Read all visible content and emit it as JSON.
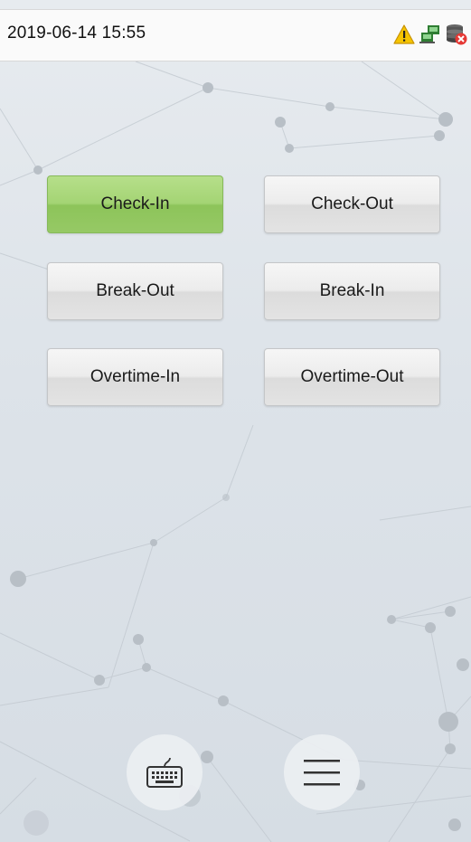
{
  "status_bar": {
    "datetime": "2019-06-14 15:55",
    "icons": [
      "warning-icon",
      "network-icon",
      "database-error-icon"
    ]
  },
  "punch_buttons": [
    {
      "label": "Check-In",
      "selected": true
    },
    {
      "label": "Check-Out",
      "selected": false
    },
    {
      "label": "Break-Out",
      "selected": false
    },
    {
      "label": "Break-In",
      "selected": false
    },
    {
      "label": "Overtime-In",
      "selected": false
    },
    {
      "label": "Overtime-Out",
      "selected": false
    }
  ],
  "bottom_controls": {
    "icons": [
      "keyboard-icon",
      "menu-icon"
    ]
  },
  "colors": {
    "selected_button": "#a4d474",
    "warning": "#f2b400",
    "network": "#4caf50",
    "error": "#e53935"
  }
}
